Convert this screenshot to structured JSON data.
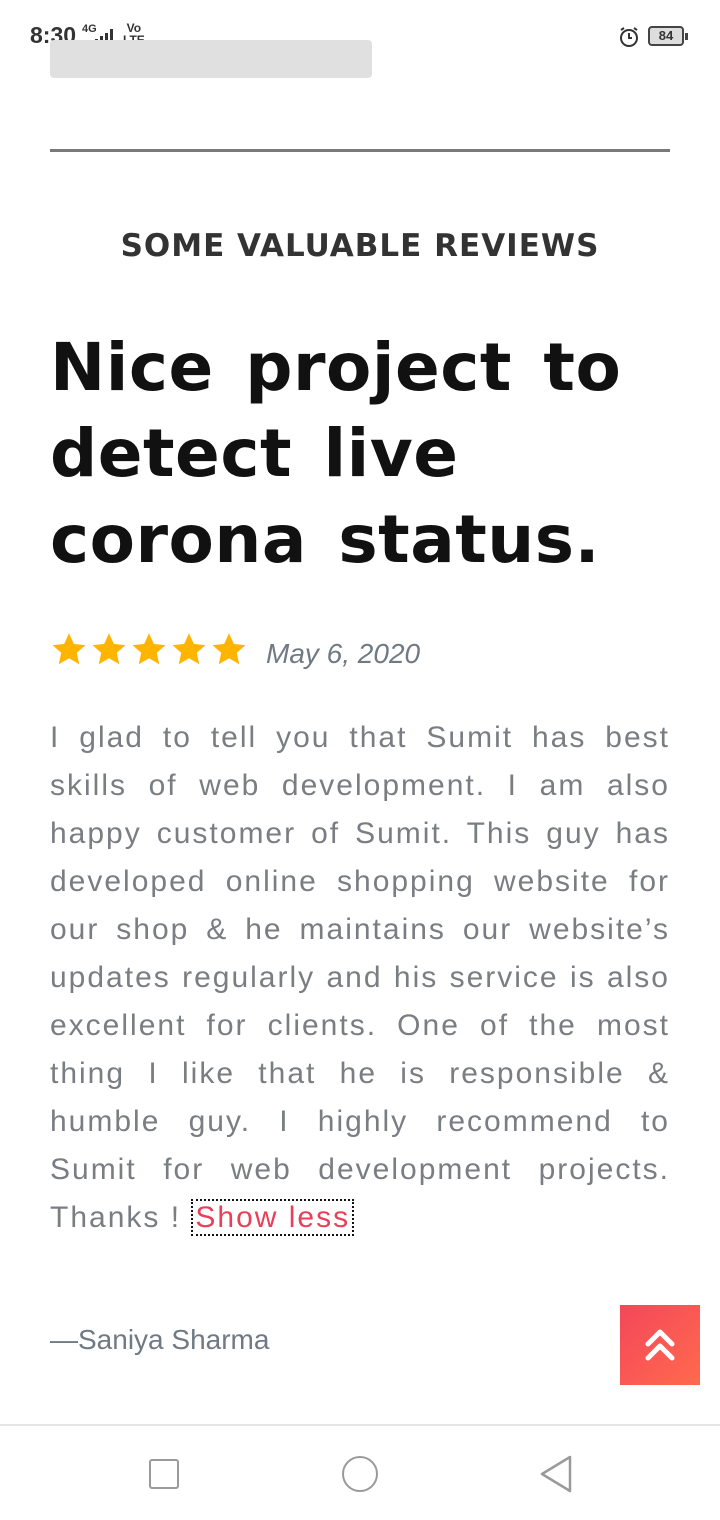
{
  "status_bar": {
    "time": "8:30",
    "network": "4G",
    "volte_top": "Vo",
    "volte_bottom": "LTE",
    "battery": "84"
  },
  "section": {
    "heading": "SOME VALUABLE REVIEWS"
  },
  "review": {
    "title": "Nice project to detect live corona status.",
    "rating": 5,
    "rating_max": 5,
    "date": "May 6, 2020",
    "body": "I glad to tell you that Sumit has best skills of web development. I am also happy customer of Sumit. This guy has developed online shopping website for our shop & he maintains our website’s updates regularly and his service is also excellent for clients. One of the most thing I like that he is responsible & humble guy. I highly recommend to Sumit for web development projects. Thanks ! ",
    "toggle_label": "Show less",
    "author": "—Saniya Sharma"
  },
  "colors": {
    "star": "#ffb400",
    "accent": "#e9405a",
    "scroll_button_start": "#f4475a",
    "scroll_button_end": "#ff6a4d"
  },
  "icons": {
    "alarm": "alarm-icon",
    "scroll_top": "double-chevron-up-icon",
    "nav_recent": "square-icon",
    "nav_home": "circle-icon",
    "nav_back": "triangle-back-icon"
  }
}
